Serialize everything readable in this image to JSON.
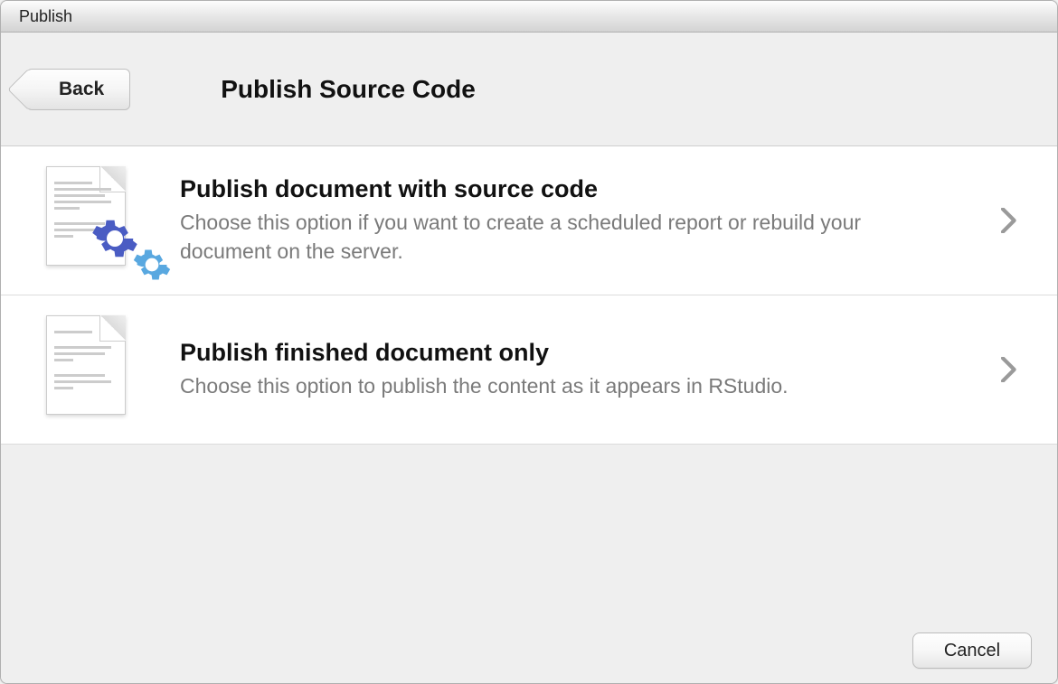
{
  "window_title": "Publish",
  "header": {
    "back_label": "Back",
    "page_title": "Publish Source Code"
  },
  "options": [
    {
      "title": "Publish document with source code",
      "description": "Choose this option if you want to create a scheduled report or rebuild your document on the server.",
      "icon": "document-gears-icon"
    },
    {
      "title": "Publish finished document only",
      "description": "Choose this option to publish the content as it appears in RStudio.",
      "icon": "document-icon"
    }
  ],
  "footer": {
    "cancel_label": "Cancel"
  }
}
